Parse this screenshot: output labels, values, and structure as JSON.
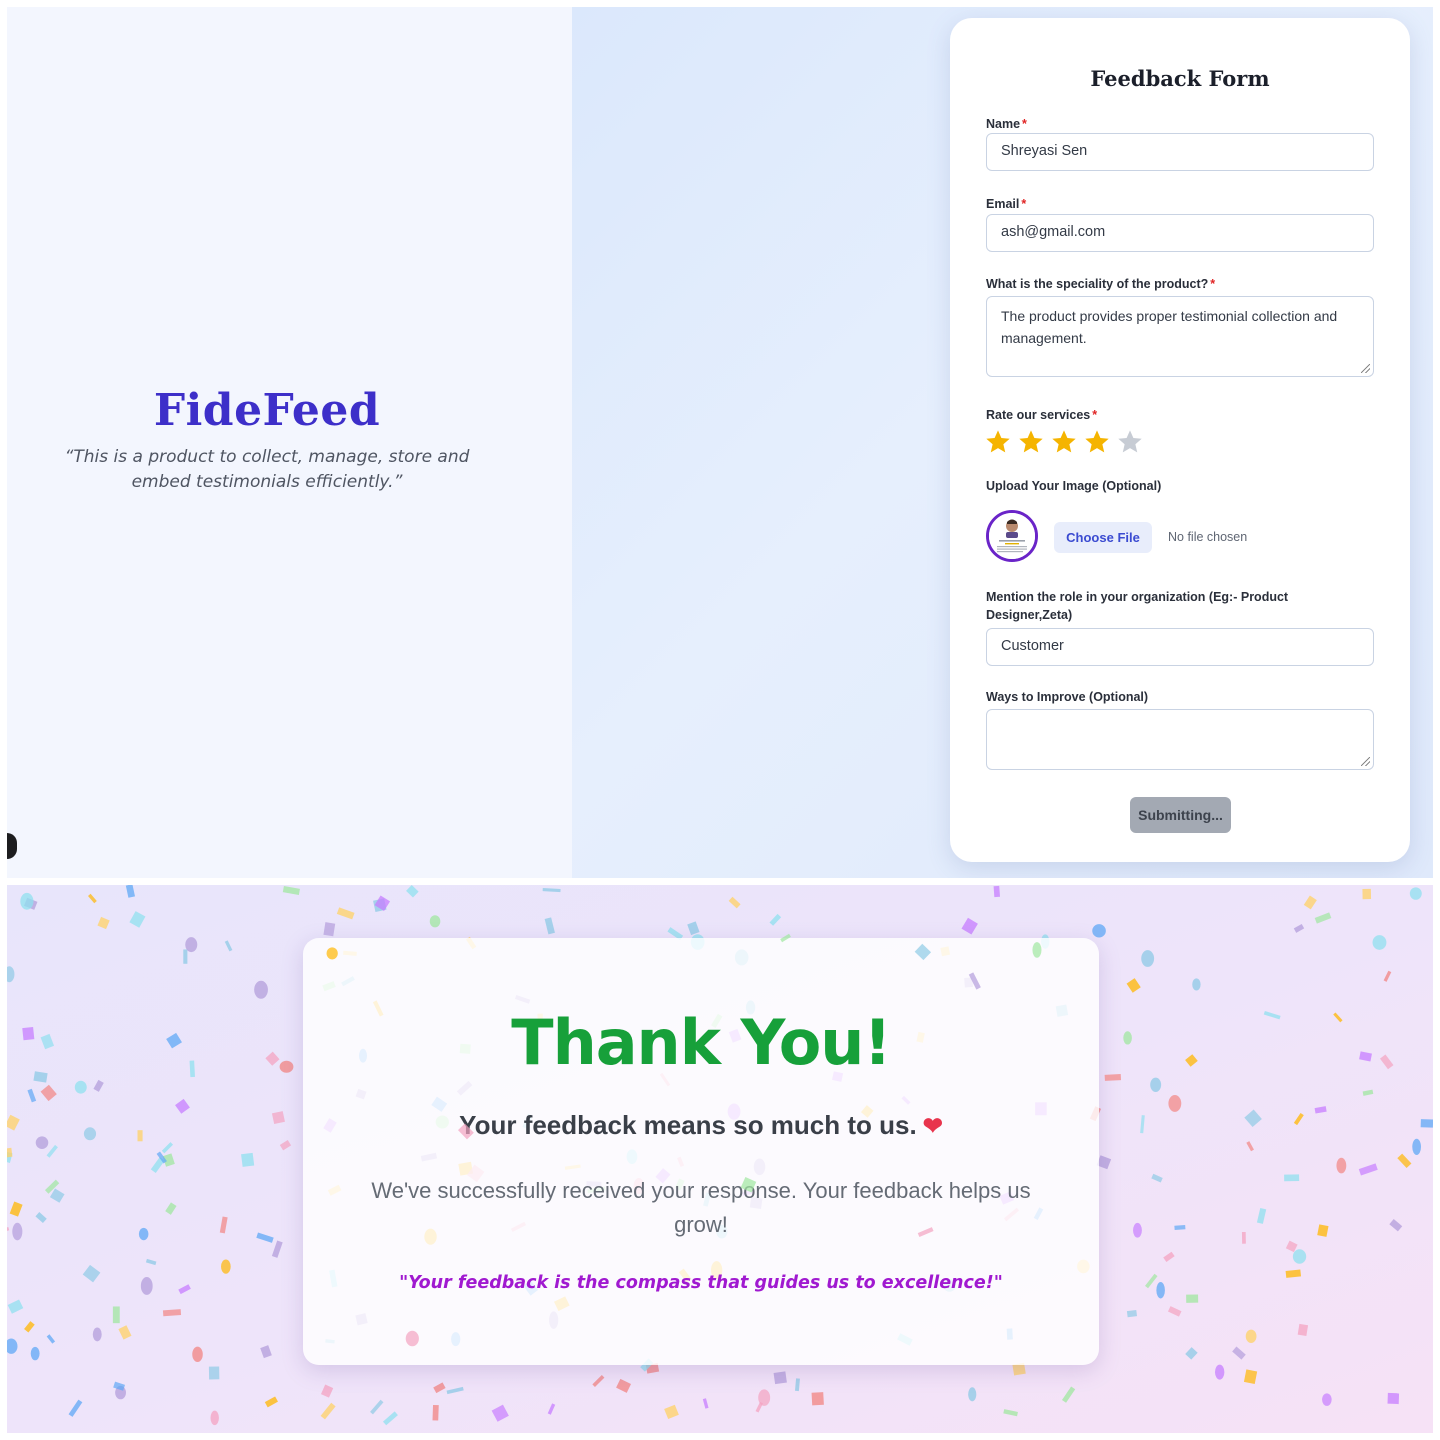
{
  "brand": {
    "name": "FideFeed",
    "tagline": "“This is a product to collect, manage, store and embed testimonials efficiently.”"
  },
  "form": {
    "title": "Feedback Form",
    "required_mark": "*",
    "name": {
      "label": "Name",
      "value": "Shreyasi Sen"
    },
    "email": {
      "label": "Email",
      "value": "ash@gmail.com"
    },
    "speciality": {
      "label": "What is the speciality of the product?",
      "value": "The product provides proper testimonial collection and management."
    },
    "rating": {
      "label": "Rate our services",
      "value": 4,
      "max": 5,
      "filled_color": "#f5b400",
      "empty_color": "#c7ccd4"
    },
    "upload": {
      "label": "Upload Your Image (Optional)",
      "button": "Choose File",
      "status": "No file chosen"
    },
    "role": {
      "label": "Mention the role in your organization (Eg:- Product Designer,Zeta)",
      "value": "Customer"
    },
    "improve": {
      "label": "Ways to Improve (Optional)",
      "value": ""
    },
    "submit": {
      "label": "Submitting..."
    }
  },
  "thank_you": {
    "title": "Thank You!",
    "subtitle": "Your feedback means so much to us.",
    "heart_icon": "heart-icon",
    "body": "We've successfully received your response. Your feedback helps us grow!",
    "quote": "\"Your feedback is the compass that guides us to excellence!\""
  },
  "colors": {
    "brand": "#3d2fc9",
    "success_green": "#17a03a",
    "quote_purple": "#a019d0"
  }
}
